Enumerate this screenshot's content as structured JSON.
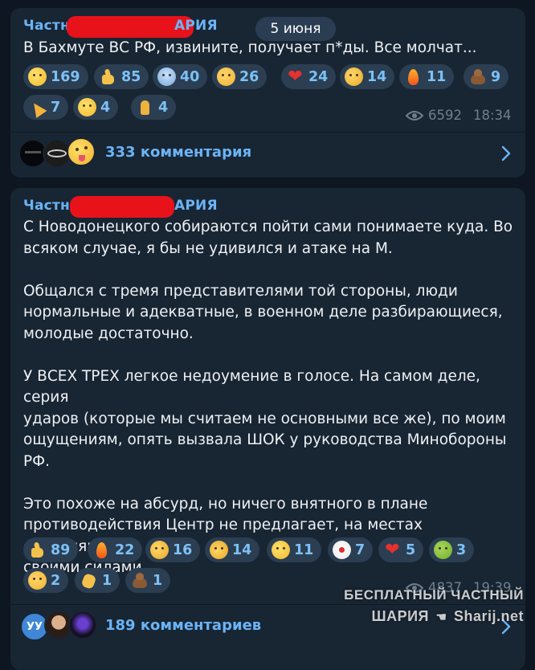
{
  "date_separator": "5 июня",
  "posts": [
    {
      "author_prefix": "Частн",
      "author_suffix": "АРИЯ",
      "text": "В Бахмуте ВС РФ, извините, получает п*ды. Все молчат...",
      "reactions": [
        {
          "icon": "rolling-laughing-emoji",
          "count": "169"
        },
        {
          "icon": "thumbs-up-emoji",
          "count": "85"
        },
        {
          "icon": "screaming-face-emoji",
          "count": "40"
        },
        {
          "icon": "crying-face-emoji",
          "count": "26"
        },
        {
          "icon": "red-heart-emoji",
          "count": "24"
        },
        {
          "icon": "thinking-face-emoji",
          "count": "14"
        },
        {
          "icon": "fire-emoji",
          "count": "11"
        },
        {
          "icon": "pile-of-poo-emoji",
          "count": "9"
        },
        {
          "icon": "party-popper-emoji",
          "count": "7"
        },
        {
          "icon": "grinning-face-emoji",
          "count": "4"
        },
        {
          "icon": "folded-hands-emoji",
          "count": "4"
        }
      ],
      "views": "6592",
      "time": "18:34",
      "comments": "333 комментария",
      "commenter_avatars": [
        "dark-channel-avatar",
        "kia-logo-avatar",
        "zany-face-avatar"
      ]
    },
    {
      "author_prefix": "Частн",
      "author_suffix": "АРИЯ",
      "text": "С Новодонецкого собираются пойти сами понимаете куда. Во\nвсяком случае, я бы не удивился и атаке на М.\n\nОбщался с тремя представителями той стороны, люди\nнормальные и адекватные, в военном деле разбирающиеся,\nмолодые достаточно.\n\nУ ВСЕХ ТРЕХ легкое недоумение в голосе. На самом деле, серия\nударов (которые мы считаем не основными все же), по моим\nощущениям, опять вызвала ШОК у руководства Минобороны\nРФ.\n\nЭто похоже на абсурд, но ничего внятного в плане\nпротиводействия Центр не предлагает, на местах справляются\nсвоими силами.",
      "reactions": [
        {
          "icon": "thumbs-up-emoji",
          "count": "89"
        },
        {
          "icon": "fire-emoji",
          "count": "22"
        },
        {
          "icon": "thinking-face-emoji",
          "count": "16"
        },
        {
          "icon": "exploding-head-emoji",
          "count": "14"
        },
        {
          "icon": "grinning-face-emoji",
          "count": "11"
        },
        {
          "icon": "clown-face-emoji",
          "count": "7"
        },
        {
          "icon": "red-heart-emoji",
          "count": "5"
        },
        {
          "icon": "vomiting-face-emoji",
          "count": "3"
        },
        {
          "icon": "crying-face-emoji",
          "count": "2"
        },
        {
          "icon": "clapping-hands-emoji",
          "count": "1"
        },
        {
          "icon": "pile-of-poo-emoji",
          "count": "1"
        }
      ],
      "views": "4837",
      "time": "19:39",
      "comments": "189 комментариев",
      "commenter_avatars": [
        "initials-avatar",
        "woman-photo-avatar",
        "dark-figure-avatar"
      ],
      "initials_avatar_text": "УУ"
    }
  ],
  "watermark": {
    "line1": "БЕСПЛАТНЫЙ ЧАСТНЫЙ",
    "line2": "ШАРИЯ",
    "line2_site": "Sharij.net"
  },
  "colors": {
    "background": "#0e1621",
    "bubble": "#182533",
    "accent": "#6bb4f5",
    "redaction": "#e8121b",
    "reaction_pill": "#2b3e52"
  }
}
